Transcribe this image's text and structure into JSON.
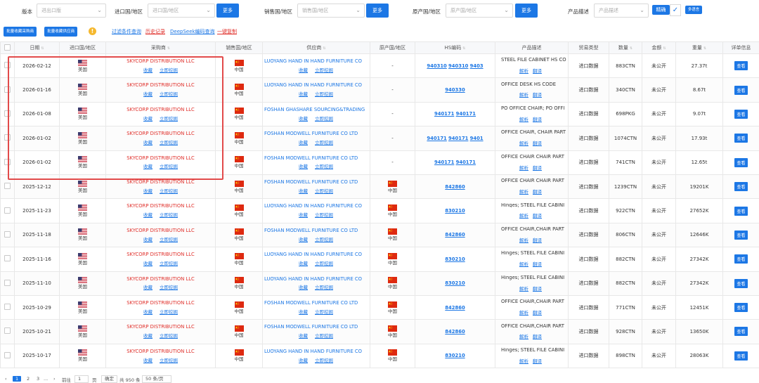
{
  "filters": {
    "version_label": "版本",
    "version_placeholder": "进出口版",
    "import_label": "进口国/地区",
    "import_placeholder": "进口国/地区",
    "more1": "更多",
    "sales_label": "销售国/地区",
    "sales_placeholder": "销售国/地区",
    "more2": "更多",
    "origin_label": "原产国/地区",
    "origin_placeholder": "原产国/地区",
    "more3": "更多",
    "desc_label": "产品描述",
    "desc_placeholder": "产品描述",
    "exact": "精确",
    "multi_lang": "多语言"
  },
  "actions": {
    "bulk_buyer": "批量收藏采购商",
    "bulk_supplier": "批量收藏供应商",
    "warn": "!",
    "filter_query": "过滤条件查询",
    "history": "历史记录",
    "deepseek": "DeepSeek编码查询",
    "copy": "一键复制"
  },
  "headers": {
    "date": "日期",
    "import_country": "进口国/地区",
    "buyer": "采购商",
    "sales_country": "销售国/地区",
    "supplier": "供应商",
    "origin_country": "原产国/地区",
    "hs": "HS编码",
    "desc": "产品描述",
    "trade_type": "贸易类型",
    "qty": "数量",
    "amount": "金额",
    "weight": "重量",
    "detail": "详单信息"
  },
  "links": {
    "fav": "收藏",
    "mine": "立即挖掘",
    "analyze": "解析",
    "translate": "翻译",
    "view": "查看"
  },
  "colors": {
    "accent": "#1c77e5",
    "buyer_red": "#e0302b",
    "highlight": "#e24a4a"
  },
  "rows": [
    {
      "date": "2026-02-12",
      "imp": "美国",
      "buyer": "SKYCORP DISTRIBUTION LLC",
      "sales": "中国",
      "supplier": "LUOYANG HAND IN HAND FURNITURE CO",
      "origin": "-",
      "origin_flag": false,
      "hs": "940310 940310 9403",
      "desc": "STEEL FILE CABINET HS CO",
      "trade": "进口数据",
      "qty": "883CTN",
      "amount": "未公开",
      "weight": "27.37t"
    },
    {
      "date": "2026-01-16",
      "imp": "美国",
      "buyer": "SKYCORP DISTRIBUTION LLC",
      "sales": "中国",
      "supplier": "LUOYANG HAND IN HAND FURNITURE CO",
      "origin": "-",
      "origin_flag": false,
      "hs": "940330",
      "desc": "OFFICE DESK HS CODE",
      "trade": "进口数据",
      "qty": "340CTN",
      "amount": "未公开",
      "weight": "8.67t"
    },
    {
      "date": "2026-01-08",
      "imp": "美国",
      "buyer": "SKYCORP DISTRIBUTION LLC",
      "sales": "中国",
      "supplier": "FOSHAN GHASHARE SOURCING&TRADING",
      "origin": "-",
      "origin_flag": false,
      "hs": "940171 940171",
      "desc": "PO OFFICE CHAIR; PO OFFI",
      "trade": "进口数据",
      "qty": "698PKG",
      "amount": "未公开",
      "weight": "9.07t"
    },
    {
      "date": "2026-01-02",
      "imp": "美国",
      "buyer": "SKYCORP DISTRIBUTION LLC",
      "sales": "中国",
      "supplier": "FOSHAN MODWELL FURNITURE CO LTD",
      "origin": "-",
      "origin_flag": false,
      "hs": "940171 940171 9401",
      "desc": "OFFICE CHAIR, CHAIR PART",
      "trade": "进口数据",
      "qty": "1074CTN",
      "amount": "未公开",
      "weight": "17.93t"
    },
    {
      "date": "2026-01-02",
      "imp": "美国",
      "buyer": "SKYCORP DISTRIBUTION LLC",
      "sales": "中国",
      "supplier": "FOSHAN MODWELL FURNITURE CO LTD",
      "origin": "-",
      "origin_flag": false,
      "hs": "940171 940171",
      "desc": "OFFICE CHAIR CHAIR PART",
      "trade": "进口数据",
      "qty": "741CTN",
      "amount": "未公开",
      "weight": "12.65t"
    },
    {
      "date": "2025-12-12",
      "imp": "美国",
      "buyer": "SKYCORP DISTRIBUTION LLC",
      "sales": "中国",
      "supplier": "FOSHAN MODWELL FURNITURE CO LTD",
      "origin": "中国",
      "origin_flag": true,
      "hs": "842860",
      "desc": "OFFICE CHAIR CHAIR PART",
      "trade": "进口数据",
      "qty": "1239CTN",
      "amount": "未公开",
      "weight": "19201K"
    },
    {
      "date": "2025-11-23",
      "imp": "美国",
      "buyer": "SKYCORP DISTRIBUTION LLC",
      "sales": "中国",
      "supplier": "LUOYANG HAND IN HAND FURNITURE CO",
      "origin": "中国",
      "origin_flag": true,
      "hs": "830210",
      "desc": "Hinges; STEEL FILE CABINI",
      "trade": "进口数据",
      "qty": "922CTN",
      "amount": "未公开",
      "weight": "27652K"
    },
    {
      "date": "2025-11-18",
      "imp": "美国",
      "buyer": "SKYCORP DISTRIBUTION LLC",
      "sales": "中国",
      "supplier": "FOSHAN MODWELL FURNITURE CO LTD",
      "origin": "中国",
      "origin_flag": true,
      "hs": "842860",
      "desc": "OFFICE CHAIR,CHAIR PART",
      "trade": "进口数据",
      "qty": "806CTN",
      "amount": "未公开",
      "weight": "12646K"
    },
    {
      "date": "2025-11-16",
      "imp": "美国",
      "buyer": "SKYCORP DISTRIBUTION LLC",
      "sales": "中国",
      "supplier": "LUOYANG HAND IN HAND FURNITURE CO",
      "origin": "中国",
      "origin_flag": true,
      "hs": "830210",
      "desc": "Hinges; STEEL FILE CABINI",
      "trade": "进口数据",
      "qty": "882CTN",
      "amount": "未公开",
      "weight": "27342K"
    },
    {
      "date": "2025-11-10",
      "imp": "美国",
      "buyer": "SKYCORP DISTRIBUTION LLC",
      "sales": "中国",
      "supplier": "LUOYANG HAND IN HAND FURNITURE CO",
      "origin": "中国",
      "origin_flag": true,
      "hs": "830210",
      "desc": "Hinges; STEEL FILE CABINI",
      "trade": "进口数据",
      "qty": "882CTN",
      "amount": "未公开",
      "weight": "27342K"
    },
    {
      "date": "2025-10-29",
      "imp": "美国",
      "buyer": "SKYCORP DISTRIBUTION LLC",
      "sales": "中国",
      "supplier": "FOSHAN MODWELL FURNITURE CO LTD",
      "origin": "中国",
      "origin_flag": true,
      "hs": "842860",
      "desc": "OFFICE CHAIR,CHAIR PART",
      "trade": "进口数据",
      "qty": "771CTN",
      "amount": "未公开",
      "weight": "12451K"
    },
    {
      "date": "2025-10-21",
      "imp": "美国",
      "buyer": "SKYCORP DISTRIBUTION LLC",
      "sales": "中国",
      "supplier": "FOSHAN MODWELL FURNITURE CO LTD",
      "origin": "中国",
      "origin_flag": true,
      "hs": "842860",
      "desc": "OFFICE CHAIR,CHAIR PART",
      "trade": "进口数据",
      "qty": "928CTN",
      "amount": "未公开",
      "weight": "13650K"
    },
    {
      "date": "2025-10-17",
      "imp": "美国",
      "buyer": "SKYCORP DISTRIBUTION LLC",
      "sales": "中国",
      "supplier": "LUOYANG HAND IN HAND FURNITURE CO",
      "origin": "中国",
      "origin_flag": true,
      "hs": "830210",
      "desc": "Hinges; STEEL FILE CABINI",
      "trade": "进口数据",
      "qty": "898CTN",
      "amount": "未公开",
      "weight": "28063K"
    }
  ],
  "pagination": {
    "prev": "‹",
    "p1": "1",
    "p2": "2",
    "p3": "3",
    "ellipsis": "...",
    "next": "›",
    "goto_label": "前往",
    "goto_value": "1",
    "page_unit": "页",
    "confirm": "确定",
    "total": "共 950 条",
    "per_page": "50 条/页"
  }
}
